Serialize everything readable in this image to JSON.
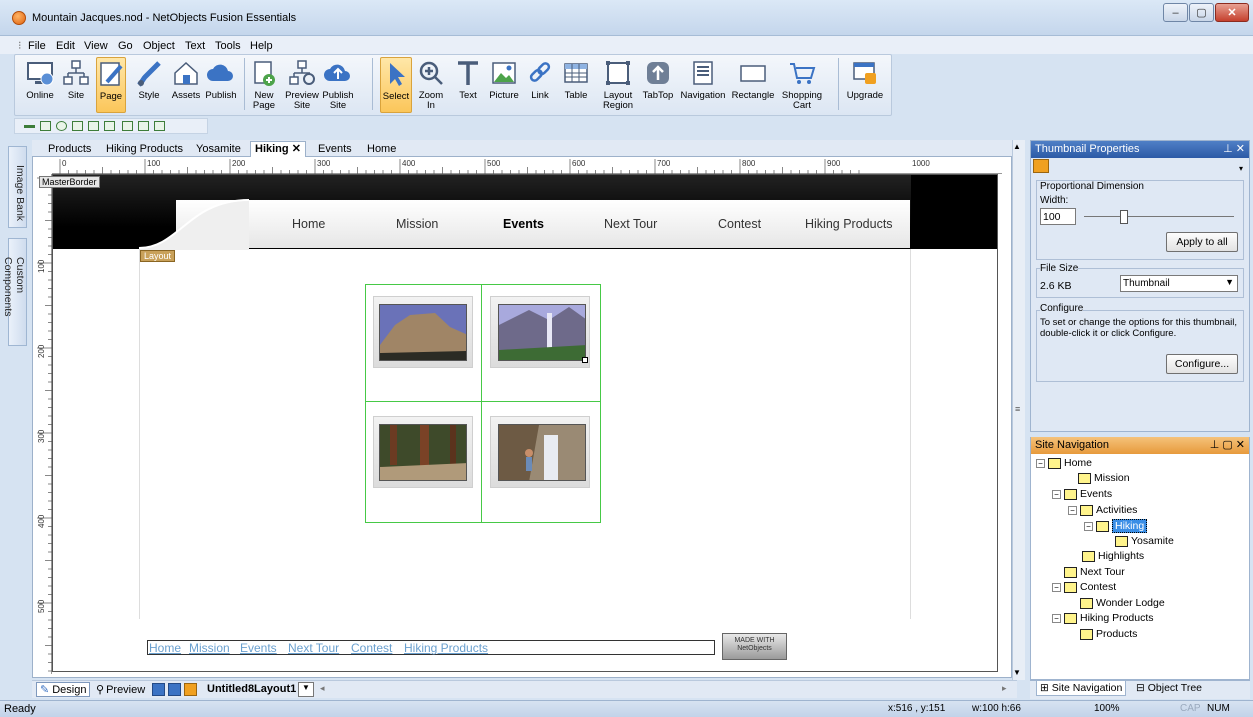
{
  "window": {
    "title": "Mountain Jacques.nod - NetObjects Fusion Essentials"
  },
  "menu": [
    "File",
    "Edit",
    "View",
    "Go",
    "Object",
    "Text",
    "Tools",
    "Help"
  ],
  "toolbar": {
    "online": "Online",
    "site": "Site",
    "page": "Page",
    "style": "Style",
    "assets": "Assets",
    "publish": "Publish",
    "new_page": "New Page",
    "preview_site": "Preview Site",
    "publish_site": "Publish Site",
    "select": "Select",
    "zoom_in": "Zoom In",
    "text": "Text",
    "picture": "Picture",
    "link": "Link",
    "table": "Table",
    "layout_region": "Layout Region",
    "tabtop": "TabTop",
    "navigation": "Navigation",
    "rectangle": "Rectangle",
    "shopping_cart": "Shopping Cart",
    "upgrade": "Upgrade"
  },
  "left_dock": {
    "image_bank": "Image Bank",
    "custom_components": "Custom Components"
  },
  "doc_tabs": [
    "Products",
    "Hiking Products",
    "Yosamite",
    "Hiking",
    "Events",
    "Home"
  ],
  "active_tab": "Hiking",
  "ruler_h": [
    "0",
    "100",
    "200",
    "300",
    "400",
    "500",
    "600",
    "700",
    "800",
    "900",
    "1000"
  ],
  "ruler_v": [
    "100",
    "200",
    "300",
    "400",
    "500"
  ],
  "canvas": {
    "master_label": "MasterBorder",
    "layout_label": "Layout",
    "nav": [
      "Home",
      "Mission",
      "Events",
      "Next Tour",
      "Contest",
      "Hiking Products"
    ],
    "nav_active": "Events",
    "footer_links": [
      "Home",
      "Mission",
      "Events",
      "Next Tour",
      "Contest",
      "Hiking Products"
    ],
    "badge": "MADE WITH NetObjects"
  },
  "bottom": {
    "design": "Design",
    "preview": "Preview",
    "layout_select": "Untitled8Layout1"
  },
  "status": {
    "ready": "Ready",
    "coords": "x:516 , y:151",
    "size": "w:100 h:66",
    "zoom": "100%",
    "cap": "CAP",
    "num": "NUM"
  },
  "thumb_props": {
    "title": "Thumbnail Properties",
    "prop_dim": "Proportional Dimension",
    "width_label": "Width:",
    "width_value": "100",
    "apply_all": "Apply to all",
    "file_size_label": "File Size",
    "file_size": "2.6 KB",
    "size_option": "Thumbnail",
    "configure_label": "Configure",
    "configure_text": "To set or change the options for this thumbnail, double-click it or click Configure.",
    "configure_btn": "Configure..."
  },
  "site_nav": {
    "title": "Site Navigation",
    "tree": [
      "Home",
      "Mission",
      "Events",
      "Activities",
      "Hiking",
      "Yosamite",
      "Highlights",
      "Next Tour",
      "Contest",
      "Wonder Lodge",
      "Hiking Products",
      "Products"
    ],
    "selected": "Hiking",
    "tab_nav": "Site Navigation",
    "tab_obj": "Object Tree"
  }
}
